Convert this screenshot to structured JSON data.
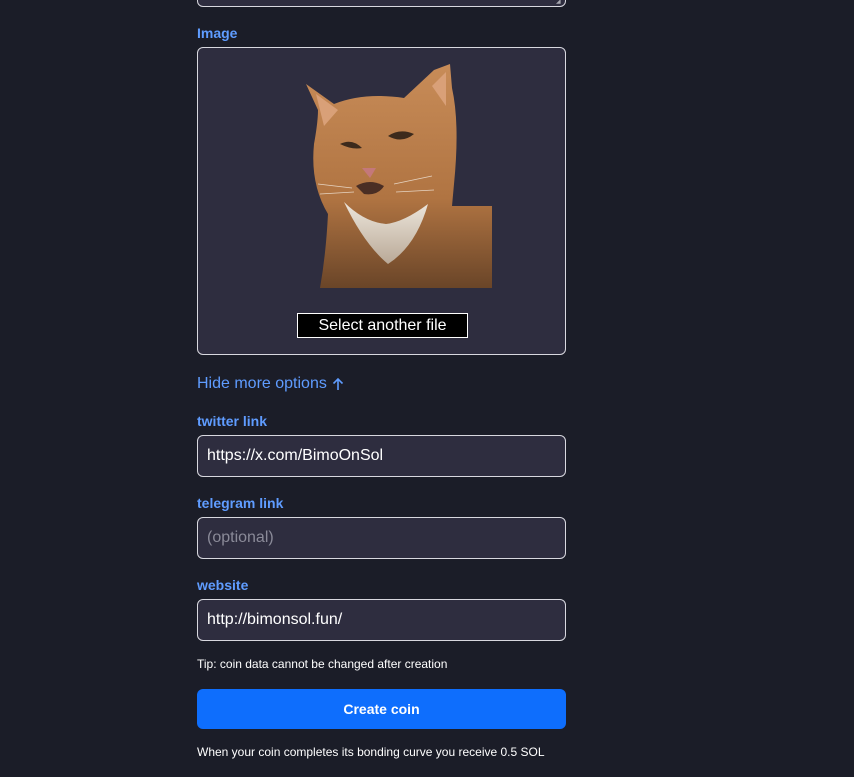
{
  "form": {
    "image_label": "Image",
    "select_file_label": "Select another file",
    "hide_options_label": "Hide more options",
    "hide_options_icon": "arrow-up-icon",
    "twitter": {
      "label": "twitter link",
      "value": "https://x.com/BimoOnSol"
    },
    "telegram": {
      "label": "telegram link",
      "value": "",
      "placeholder": "(optional)"
    },
    "website": {
      "label": "website",
      "value": "http://bimonsol.fun/"
    },
    "tip": "Tip: coin data cannot be changed after creation",
    "create_label": "Create coin",
    "bonding_note": "When your coin completes its bonding curve you receive 0.5 SOL"
  },
  "colors": {
    "background": "#1b1d28",
    "field_bg": "#2e2d3f",
    "label_blue": "#5f9cff",
    "primary_button": "#0e6efd"
  }
}
